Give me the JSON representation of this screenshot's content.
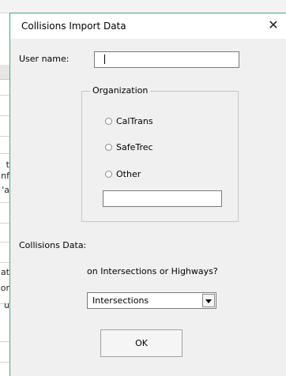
{
  "dialog": {
    "title": "Collisions Import Data",
    "close_glyph": "✕",
    "user_name_label": "User name:",
    "user_name_value": "",
    "organization": {
      "legend": "Organization",
      "options": [
        "CalTrans",
        "SafeTrec",
        "Other"
      ],
      "other_value": ""
    },
    "collisions_data_label": "Collisions Data:",
    "question": "on Intersections or Highways?",
    "location_selected": "Intersections",
    "ok_label": "OK"
  },
  "background": {
    "cells": [
      "t",
      "nf",
      "'a",
      "at",
      "or",
      "u"
    ]
  }
}
